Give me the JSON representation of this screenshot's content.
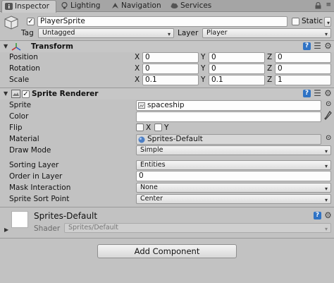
{
  "tabs": [
    {
      "label": "Inspector",
      "icon": "info-icon"
    },
    {
      "label": "Lighting",
      "icon": "light-bulb-icon"
    },
    {
      "label": "Navigation",
      "icon": "navigation-icon"
    },
    {
      "label": "Services",
      "icon": "cloud-icon"
    }
  ],
  "object": {
    "name": "PlayerSprite",
    "static_label": "Static",
    "tag_label": "Tag",
    "tag_value": "Untagged",
    "layer_label": "Layer",
    "layer_value": "Player"
  },
  "transform": {
    "title": "Transform",
    "rows": [
      {
        "label": "Position",
        "x": "0",
        "y": "0",
        "z": "0"
      },
      {
        "label": "Rotation",
        "x": "0",
        "y": "0",
        "z": "0"
      },
      {
        "label": "Scale",
        "x": "0.1",
        "y": "0.1",
        "z": "1"
      }
    ],
    "axis": {
      "x": "X",
      "y": "Y",
      "z": "Z"
    }
  },
  "sprite_renderer": {
    "title": "Sprite Renderer",
    "sprite_label": "Sprite",
    "sprite_value": "spaceship",
    "color_label": "Color",
    "flip_label": "Flip",
    "flip_x": "X",
    "flip_y": "Y",
    "material_label": "Material",
    "material_value": "Sprites-Default",
    "draw_mode_label": "Draw Mode",
    "draw_mode_value": "Simple",
    "sorting_layer_label": "Sorting Layer",
    "sorting_layer_value": "Entities",
    "order_label": "Order in Layer",
    "order_value": "0",
    "mask_label": "Mask Interaction",
    "mask_value": "None",
    "sort_point_label": "Sprite Sort Point",
    "sort_point_value": "Center"
  },
  "material_section": {
    "name": "Sprites-Default",
    "shader_label": "Shader",
    "shader_value": "Sprites/Default"
  },
  "add_component_label": "Add Component",
  "help_glyph": "?",
  "gear_glyph": "⚙",
  "colors": {
    "accent": "#2f73c5",
    "panel": "#c2c2c2",
    "tabbar": "#a5a5a5"
  }
}
